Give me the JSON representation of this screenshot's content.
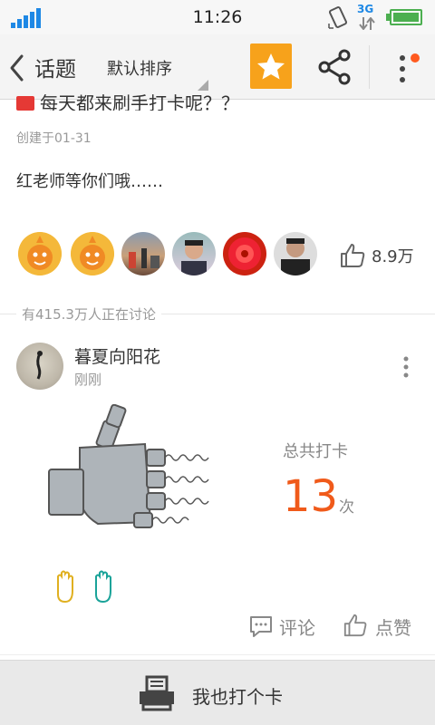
{
  "status": {
    "time": "11:26",
    "network": "3G"
  },
  "header": {
    "back_label": "话题",
    "sort_label": "默认排序"
  },
  "topic": {
    "title": "每天都来刷手打卡呢？？",
    "created": "创建于01-31",
    "description": "红老师等你们哦……",
    "likes": "8.9万",
    "discussing": "有415.3万人正在讨论"
  },
  "post": {
    "author": "暮夏向阳花",
    "time": "刚刚",
    "total_label": "总共打卡",
    "total_count": "13",
    "total_unit": "次",
    "comment_label": "评论",
    "praise_label": "点赞"
  },
  "bottom": {
    "checkin_label": "我也打个卡"
  },
  "colors": {
    "accent": "#f7a21b",
    "highlight": "#f05a1a",
    "notify_dot": "#ff5a1f"
  }
}
